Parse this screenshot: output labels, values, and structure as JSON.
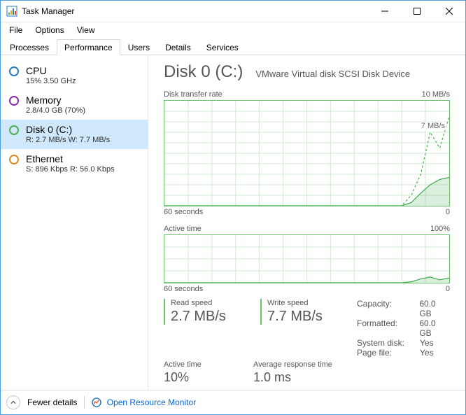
{
  "window": {
    "title": "Task Manager"
  },
  "menu": {
    "file": "File",
    "options": "Options",
    "view": "View"
  },
  "tabs": {
    "processes": "Processes",
    "performance": "Performance",
    "users": "Users",
    "details": "Details",
    "services": "Services",
    "active": "performance"
  },
  "sidebar": {
    "cpu": {
      "title": "CPU",
      "sub": "15%  3.50 GHz"
    },
    "memory": {
      "title": "Memory",
      "sub": "2.8/4.0 GB (70%)"
    },
    "disk": {
      "title": "Disk 0 (C:)",
      "sub": "R: 2.7 MB/s W: 7.7 MB/s"
    },
    "eth": {
      "title": "Ethernet",
      "sub": "S: 896 Kbps R: 56.0 Kbps"
    },
    "selected": "disk"
  },
  "main": {
    "title": "Disk 0 (C:)",
    "device": "VMware Virtual disk SCSI Disk Device",
    "transfer": {
      "label": "Disk transfer rate",
      "ymax_label": "10 MB/s",
      "marker_label": "7 MB/s",
      "xleft": "60 seconds",
      "xright": "0"
    },
    "active": {
      "label": "Active time",
      "ymax_label": "100%",
      "xleft": "60 seconds",
      "xright": "0"
    },
    "metrics": {
      "read_label": "Read speed",
      "read_value": "2.7 MB/s",
      "write_label": "Write speed",
      "write_value": "7.7 MB/s",
      "active_label": "Active time",
      "active_value": "10%",
      "resp_label": "Average response time",
      "resp_value": "1.0 ms",
      "capacity_k": "Capacity:",
      "capacity_v": "60.0 GB",
      "formatted_k": "Formatted:",
      "formatted_v": "60.0 GB",
      "sysdisk_k": "System disk:",
      "sysdisk_v": "Yes",
      "pagefile_k": "Page file:",
      "pagefile_v": "Yes"
    }
  },
  "footer": {
    "fewer": "Fewer details",
    "resmon": "Open Resource Monitor"
  },
  "chart_data": [
    {
      "type": "line",
      "title": "Disk transfer rate",
      "xlabel": "seconds ago",
      "ylabel": "MB/s",
      "ylim": [
        0,
        10
      ],
      "x": [
        60,
        55,
        50,
        45,
        40,
        35,
        30,
        25,
        20,
        15,
        10,
        8,
        6,
        4,
        2,
        0
      ],
      "series": [
        {
          "name": "Read",
          "values": [
            0,
            0,
            0,
            0,
            0,
            0,
            0,
            0,
            0,
            0,
            0,
            0.3,
            1.2,
            2.0,
            2.5,
            2.7
          ]
        },
        {
          "name": "Write",
          "values": [
            0,
            0,
            0,
            0,
            0,
            0,
            0,
            0,
            0,
            0,
            0,
            1.0,
            3.0,
            7.0,
            5.5,
            8.5
          ]
        }
      ],
      "annotations": [
        "7 MB/s"
      ]
    },
    {
      "type": "line",
      "title": "Active time",
      "xlabel": "seconds ago",
      "ylabel": "%",
      "ylim": [
        0,
        100
      ],
      "x": [
        60,
        55,
        50,
        45,
        40,
        35,
        30,
        25,
        20,
        15,
        10,
        8,
        6,
        4,
        2,
        0
      ],
      "series": [
        {
          "name": "Active time",
          "values": [
            0,
            0,
            0,
            0,
            0,
            0,
            0,
            0,
            0,
            0,
            0,
            2,
            8,
            12,
            6,
            10
          ]
        }
      ]
    }
  ]
}
